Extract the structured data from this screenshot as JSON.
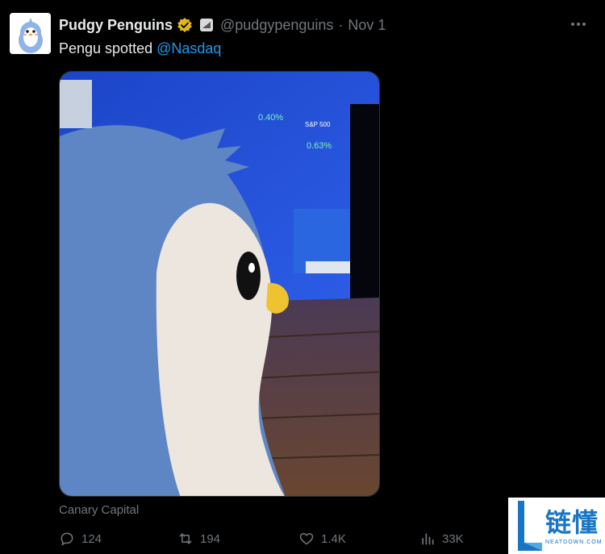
{
  "author": {
    "display_name": "Pudgy Penguins",
    "handle": "@pudgypenguins",
    "separator": "·",
    "date": "Nov 1"
  },
  "tweet": {
    "text": "Pengu spotted",
    "mention": "@Nasdaq"
  },
  "media": {
    "caption": "Canary Capital"
  },
  "actions": {
    "replies": "124",
    "reposts": "194",
    "likes": "1.4K",
    "views": "33K"
  },
  "watermark": {
    "text": "链懂",
    "sub": "NEATDOWN.COM"
  },
  "icons": {
    "verified": "verified-gold-badge-icon",
    "affiliate": "affiliate-badge-icon",
    "more": "more-dots-icon",
    "reply": "reply-bubble-icon",
    "repost": "repost-arrows-icon",
    "like": "heart-icon",
    "views": "views-bars-icon"
  },
  "colors": {
    "background": "#000000",
    "text": "#e7e9ea",
    "muted": "#71767b",
    "accent": "#1d9bf0",
    "verified_gold": "#e2b719"
  }
}
